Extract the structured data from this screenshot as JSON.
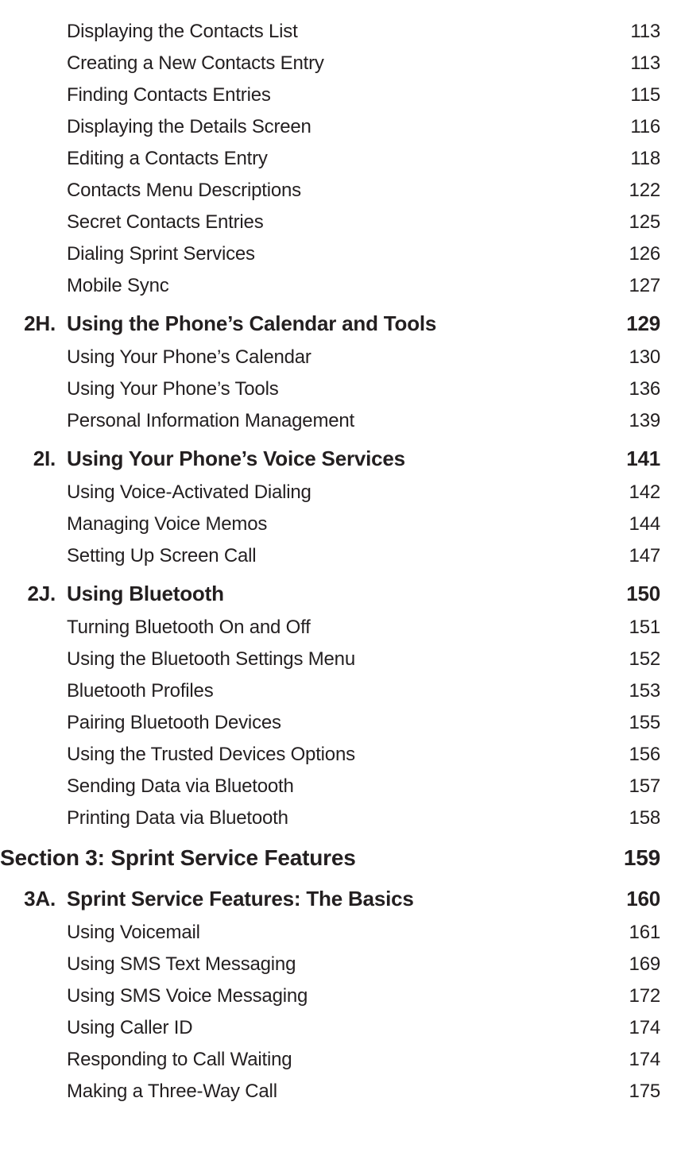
{
  "toc": [
    {
      "level": 3,
      "prefix": "",
      "title": "Displaying the Contacts List",
      "page": "113"
    },
    {
      "level": 3,
      "prefix": "",
      "title": "Creating a New Contacts Entry",
      "page": "113"
    },
    {
      "level": 3,
      "prefix": "",
      "title": "Finding Contacts Entries",
      "page": "115"
    },
    {
      "level": 3,
      "prefix": "",
      "title": "Displaying the Details Screen",
      "page": "116"
    },
    {
      "level": 3,
      "prefix": "",
      "title": "Editing a Contacts Entry",
      "page": "118"
    },
    {
      "level": 3,
      "prefix": "",
      "title": "Contacts Menu Descriptions",
      "page": "122"
    },
    {
      "level": 3,
      "prefix": "",
      "title": "Secret Contacts Entries",
      "page": "125"
    },
    {
      "level": 3,
      "prefix": "",
      "title": "Dialing Sprint Services",
      "page": "126"
    },
    {
      "level": 3,
      "prefix": "",
      "title": "Mobile Sync",
      "page": "127"
    },
    {
      "level": 2,
      "prefix": "2H.",
      "title": "Using the Phone’s Calendar and Tools",
      "page": "129"
    },
    {
      "level": 3,
      "prefix": "",
      "title": "Using Your Phone’s Calendar",
      "page": "130"
    },
    {
      "level": 3,
      "prefix": "",
      "title": "Using Your Phone’s Tools",
      "page": "136"
    },
    {
      "level": 3,
      "prefix": "",
      "title": "Personal Information Management",
      "page": "139"
    },
    {
      "level": 2,
      "prefix": "2I.",
      "title": "Using Your Phone’s Voice Services",
      "page": "141"
    },
    {
      "level": 3,
      "prefix": "",
      "title": "Using Voice-Activated Dialing",
      "page": "142"
    },
    {
      "level": 3,
      "prefix": "",
      "title": "Managing Voice Memos",
      "page": "144"
    },
    {
      "level": 3,
      "prefix": "",
      "title": "Setting Up Screen Call",
      "page": "147"
    },
    {
      "level": 2,
      "prefix": "2J.",
      "title": "Using Bluetooth",
      "page": "150"
    },
    {
      "level": 3,
      "prefix": "",
      "title": "Turning Bluetooth On and Off",
      "page": "151"
    },
    {
      "level": 3,
      "prefix": "",
      "title": "Using the Bluetooth Settings Menu",
      "page": "152"
    },
    {
      "level": 3,
      "prefix": "",
      "title": "Bluetooth Profiles",
      "page": "153"
    },
    {
      "level": 3,
      "prefix": "",
      "title": "Pairing Bluetooth Devices",
      "page": "155"
    },
    {
      "level": 3,
      "prefix": "",
      "title": "Using the Trusted Devices Options",
      "page": "156"
    },
    {
      "level": 3,
      "prefix": "",
      "title": "Sending Data via Bluetooth",
      "page": "157"
    },
    {
      "level": 3,
      "prefix": "",
      "title": "Printing Data via Bluetooth",
      "page": "158"
    },
    {
      "level": 1,
      "prefix": "",
      "title": "Section 3: Sprint Service Features",
      "page": "159"
    },
    {
      "level": 2,
      "prefix": "3A.",
      "title": "Sprint Service Features: The Basics",
      "page": "160"
    },
    {
      "level": 3,
      "prefix": "",
      "title": "Using Voicemail",
      "page": "161"
    },
    {
      "level": 3,
      "prefix": "",
      "title": "Using SMS Text Messaging",
      "page": "169"
    },
    {
      "level": 3,
      "prefix": "",
      "title": "Using SMS Voice Messaging",
      "page": "172"
    },
    {
      "level": 3,
      "prefix": "",
      "title": "Using Caller ID",
      "page": "174"
    },
    {
      "level": 3,
      "prefix": "",
      "title": "Responding to Call Waiting",
      "page": "174"
    },
    {
      "level": 3,
      "prefix": "",
      "title": "Making a Three-Way Call",
      "page": "175"
    }
  ]
}
